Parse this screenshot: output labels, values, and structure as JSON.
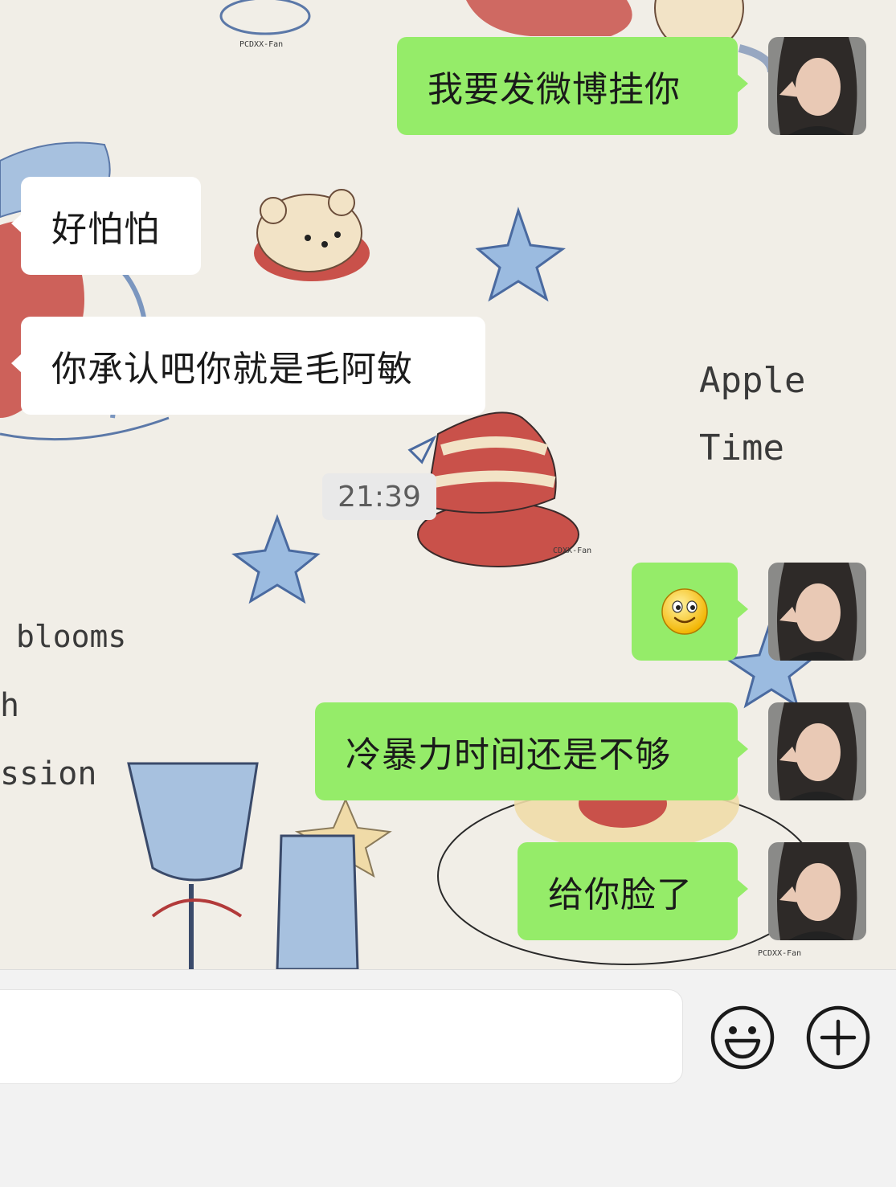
{
  "conversation": {
    "messages": [
      {
        "side": "out",
        "text": "我要发微博挂你"
      },
      {
        "side": "in",
        "text": "好怕怕"
      },
      {
        "side": "in",
        "text": "你承认吧你就是毛阿敏"
      },
      {
        "side": "out",
        "text": "冷暴力时间还是不够"
      },
      {
        "side": "out",
        "text": "给你脸了"
      }
    ],
    "emoji_message": {
      "side": "out",
      "icon": "smiling-face-emoji"
    },
    "timestamp": "21:39"
  },
  "wallpaper": {
    "apple_line1": "Apple",
    "apple_line2": "Time",
    "blooms": "blooms",
    "h": "h",
    "ssion": "ssion",
    "watermark": "PCDXX-Fan",
    "watermark_short": "CDXX-Fan"
  },
  "composer": {
    "input_value": "",
    "emoji_button_icon": "emoji-face-icon",
    "plus_button_icon": "plus-circle-icon"
  },
  "colors": {
    "outgoing_bubble": "#95ec69",
    "incoming_bubble": "#ffffff",
    "composer_background": "#f2f2f2"
  }
}
